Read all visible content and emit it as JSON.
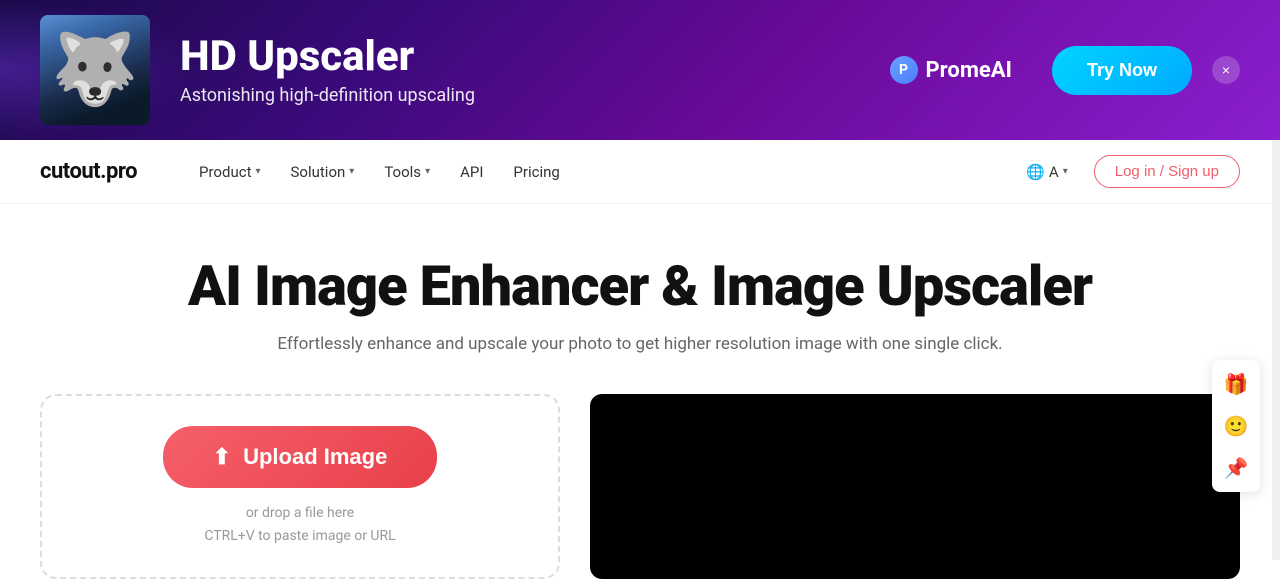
{
  "banner": {
    "title": "HD Upscaler",
    "subtitle": "Astonishing high-definition upscaling",
    "brand": "PromeAI",
    "cta_label": "Try Now",
    "close_label": "×"
  },
  "navbar": {
    "logo": "cutout.pro",
    "links": [
      {
        "label": "Product",
        "has_dropdown": true
      },
      {
        "label": "Solution",
        "has_dropdown": true
      },
      {
        "label": "Tools",
        "has_dropdown": true
      },
      {
        "label": "API",
        "has_dropdown": false
      },
      {
        "label": "Pricing",
        "has_dropdown": false
      }
    ],
    "lang_label": "A",
    "auth_label": "Log in / Sign up"
  },
  "hero": {
    "title": "AI Image Enhancer & Image Upscaler",
    "subtitle": "Effortlessly enhance and upscale your photo to get higher resolution image with one single click."
  },
  "upload": {
    "button_label": "Upload Image",
    "hint_line1": "or drop a file here",
    "hint_line2": "CTRL+V to paste image or URL"
  },
  "side_actions": [
    {
      "name": "gift-icon",
      "emoji": "🎁"
    },
    {
      "name": "avatar-icon",
      "emoji": "🙂"
    },
    {
      "name": "notification-icon",
      "emoji": "📌"
    }
  ],
  "colors": {
    "accent": "#f5606a",
    "banner_bg_start": "#1a0a4a",
    "banner_bg_end": "#8b1fcf",
    "cta_bg": "#00c8ff"
  }
}
